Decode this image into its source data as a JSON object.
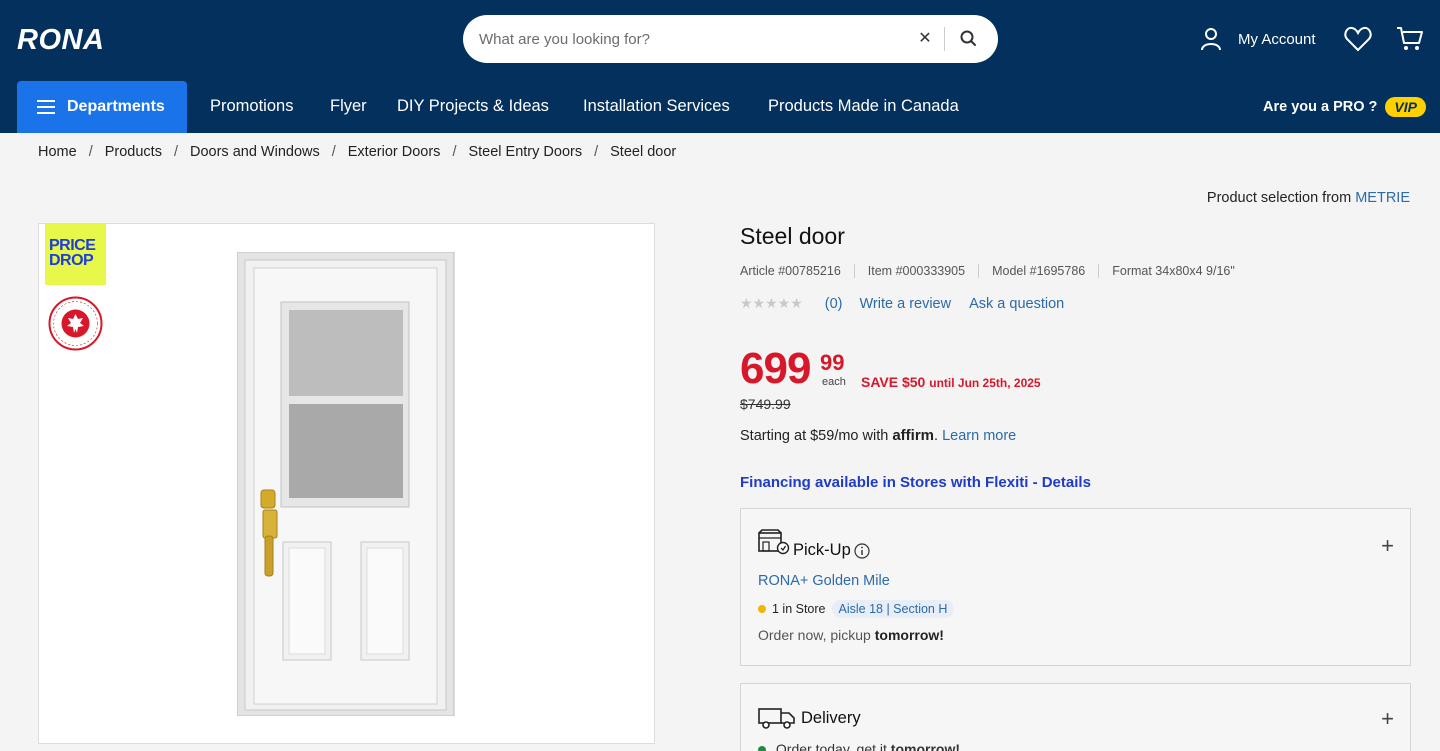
{
  "header": {
    "logo": "RONA",
    "search": {
      "placeholder": "What are you looking for?",
      "value": ""
    },
    "account_label": "My Account",
    "departments_label": "Departments",
    "nav": [
      "Promotions",
      "Flyer",
      "DIY Projects & Ideas",
      "Installation Services",
      "Products Made in Canada"
    ],
    "pro_label": "Are you a PRO ?",
    "vip_label": "VIP"
  },
  "breadcrumb": [
    "Home",
    "Products",
    "Doors and Windows",
    "Exterior Doors",
    "Steel Entry Doors",
    "Steel door"
  ],
  "selection": {
    "prefix": "Product selection from",
    "brand": "METRIE"
  },
  "badges": {
    "price_drop_line1": "PRICE",
    "price_drop_line2": "DROP",
    "well_made": "WELL MADE HERE · BIEN FAIT ICI"
  },
  "product": {
    "title": "Steel door",
    "article": "Article #00785216",
    "item": "Item #000333905",
    "model": "Model #1695786",
    "format": "Format 34x80x4 9/16\"",
    "review_count": "(0)",
    "write_review": "Write a review",
    "ask_question": "Ask a question",
    "price_dollars": "699",
    "price_cents": "99",
    "price_unit": "each",
    "save": "SAVE $50",
    "save_until": "until Jun 25th, 2025",
    "old_price": "$749.99",
    "affirm_prefix": "Starting at $59/mo with",
    "affirm_brand": "affirm",
    "affirm_link": "Learn more",
    "financing": "Financing available in Stores with Flexiti - Details"
  },
  "pickup": {
    "title": "Pick-Up",
    "store": "RONA+ Golden Mile",
    "stock": "1 in Store",
    "aisle": "Aisle  18 | Section H",
    "note_prefix": "Order now, pickup",
    "note_bold": "tomorrow!"
  },
  "delivery": {
    "title": "Delivery",
    "note_prefix": "Order today, get it",
    "note_bold": "tomorrow!"
  },
  "colors": {
    "header": "#03305c",
    "departments": "#1a73e8",
    "price": "#d7182a",
    "link": "#2c6aa8",
    "vip": "#ffd100"
  }
}
